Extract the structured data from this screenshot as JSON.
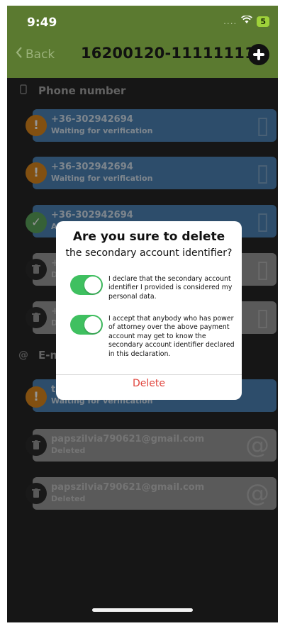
{
  "status_bar": {
    "time": "9:49",
    "signal": "....",
    "battery": "5"
  },
  "nav": {
    "back_label": "Back",
    "title": "16200120-11111111"
  },
  "phone_section": {
    "title": "Phone number",
    "items": [
      {
        "line1": "+36-302942694",
        "line2": "Waiting for verification"
      },
      {
        "line1": "+36-302942694",
        "line2": "Waiting for verification"
      },
      {
        "line1": "+36-302942694",
        "line2": "A"
      },
      {
        "line1": "+",
        "line2": "D"
      },
      {
        "line1": "+",
        "line2": "D"
      }
    ]
  },
  "email_section": {
    "title": "E-m",
    "items": [
      {
        "line1": "te",
        "line2": "Waiting for verification"
      },
      {
        "line1": "papszilvia790621@gmail.com",
        "line2": "Deleted"
      },
      {
        "line1": "papszilvia790621@gmail.com",
        "line2": "Deleted"
      }
    ]
  },
  "dialog": {
    "title": "Are you sure to delete",
    "subtitle": "the secondary account identifier?",
    "option1": "I declare that the secondary account identifier I provided is considered my personal data.",
    "option2": "I accept that anybody who has power of attorney over the above payment account may get to know the secondary account identifier declared in this declaration.",
    "delete_label": "Delete"
  },
  "icons": {
    "phone": "phone-icon",
    "email": "at-icon",
    "warning": "exclamation-icon",
    "verified": "checkmark-icon",
    "deleted": "trash-icon"
  },
  "colors": {
    "header": "#5b7a30",
    "card_pending": "#4f86b8",
    "card_deleted": "#9c9c9c",
    "toggle_on": "#3fc060",
    "delete": "#e0433b"
  }
}
